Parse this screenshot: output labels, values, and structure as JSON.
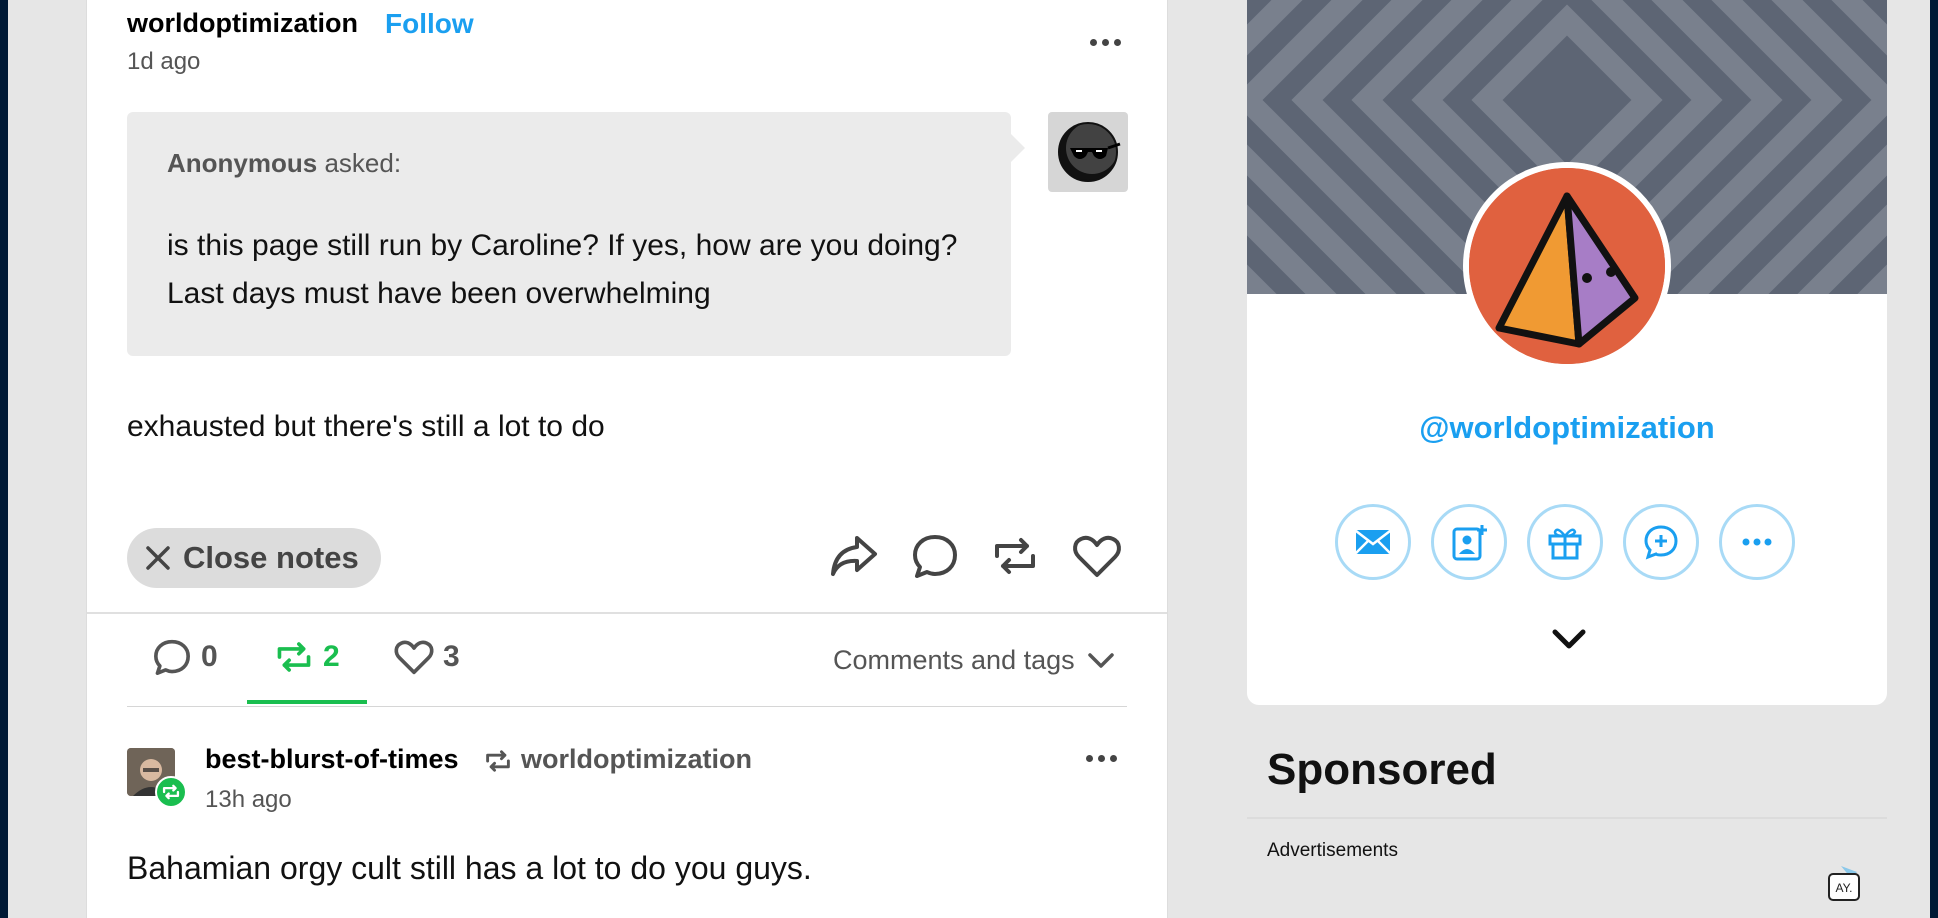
{
  "colors": {
    "accent": "#1a9ff0",
    "reblog_green": "#1abe4f",
    "avatar_orange": "#e0613f",
    "banner": "#5d6574"
  },
  "post": {
    "author": "worldoptimization",
    "follow_label": "Follow",
    "time": "1d ago",
    "ask": {
      "asker": "Anonymous",
      "asked_suffix": " asked:",
      "question": "is this page still run by Caroline? If yes, how are you doing? Last days must have been overwhelming"
    },
    "answer": "exhausted but there's still a lot to do",
    "close_notes_label": "Close notes",
    "actions": [
      "share-icon",
      "reply-icon",
      "reblog-icon",
      "like-icon"
    ]
  },
  "notes": {
    "tabs": [
      {
        "icon": "comment-icon",
        "count": "0"
      },
      {
        "icon": "reblog-icon",
        "count": "2"
      },
      {
        "icon": "heart-icon",
        "count": "3"
      }
    ],
    "active_tab": "reblogs",
    "filter_label": "Comments and tags",
    "reblog": {
      "user": "best-blurst-of-times",
      "source": "worldoptimization",
      "time": "13h ago",
      "text": "Bahamian orgy cult still has a lot to do you guys."
    }
  },
  "sidebar": {
    "handle": "@worldoptimization",
    "buttons": [
      "mail-icon",
      "follow-contact-icon",
      "gift-icon",
      "ask-icon",
      "more-icon"
    ],
    "sponsored_label": "Sponsored",
    "ads_label": "Advertisements",
    "adchoices_label": "AY."
  }
}
